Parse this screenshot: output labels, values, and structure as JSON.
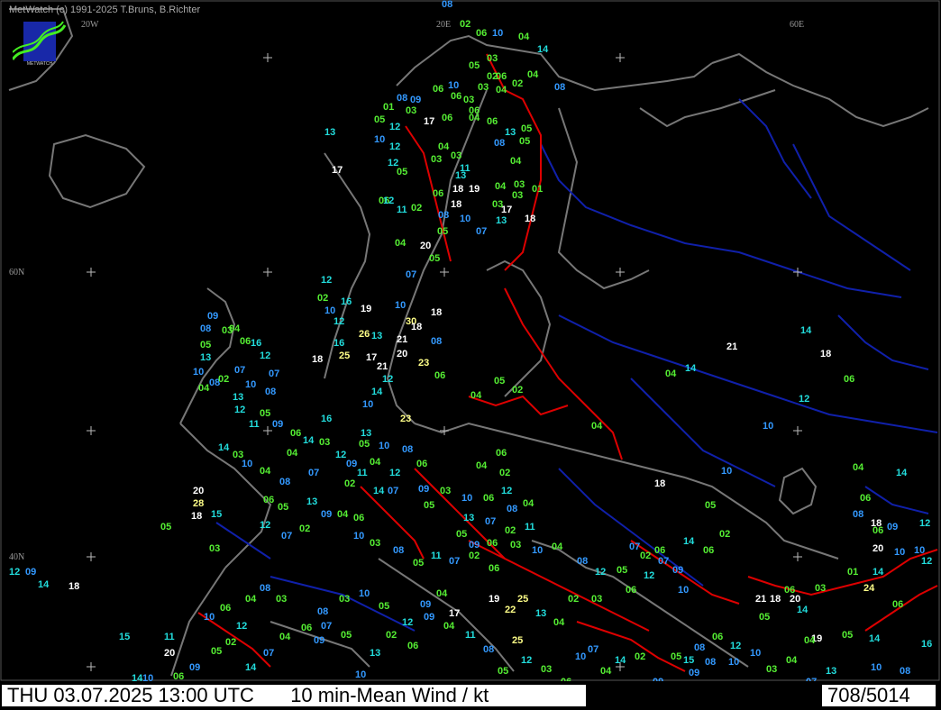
{
  "header": {
    "copyright": "MetWatch  (c) 1991-2025 T.Bruns, B.Richter"
  },
  "logo": {
    "text": "METWATCH",
    "icon": "metwatch-logo-icon"
  },
  "graticule": {
    "lon_labels": [
      "20W",
      "20E",
      "60E"
    ],
    "lat_labels": [
      "60N",
      "40N"
    ]
  },
  "legend": {
    "colors": {
      "calm": "#55ee33",
      "light": "#3399ff",
      "moderate": "#22dddd",
      "strong": "#ffffff",
      "gale": "#ffff88"
    }
  },
  "footer": {
    "datetime": "THU 03.07.2025 13:00 UTC",
    "parameter": "10 min-Mean Wind / kt",
    "count": "708/5014"
  },
  "observations": [
    {
      "v": "08",
      "c": "light"
    },
    {
      "v": "02",
      "c": "calm"
    },
    {
      "v": "06",
      "c": "calm"
    },
    {
      "v": "10",
      "c": "light"
    },
    {
      "v": "04",
      "c": "calm"
    },
    {
      "v": "14",
      "c": "moderate"
    },
    {
      "v": "03",
      "c": "calm"
    },
    {
      "v": "05",
      "c": "calm"
    },
    {
      "v": "06",
      "c": "calm"
    },
    {
      "v": "02",
      "c": "calm"
    },
    {
      "v": "04",
      "c": "calm"
    },
    {
      "v": "04",
      "c": "calm"
    },
    {
      "v": "10",
      "c": "light"
    },
    {
      "v": "06",
      "c": "calm"
    },
    {
      "v": "03",
      "c": "calm"
    },
    {
      "v": "02",
      "c": "calm"
    },
    {
      "v": "03",
      "c": "calm"
    },
    {
      "v": "08",
      "c": "light"
    },
    {
      "v": "08",
      "c": "light"
    },
    {
      "v": "09",
      "c": "light"
    },
    {
      "v": "05",
      "c": "calm"
    },
    {
      "v": "01",
      "c": "calm"
    },
    {
      "v": "03",
      "c": "calm"
    },
    {
      "v": "06",
      "c": "calm"
    },
    {
      "v": "06",
      "c": "calm"
    },
    {
      "v": "04",
      "c": "calm"
    },
    {
      "v": "12",
      "c": "moderate"
    },
    {
      "v": "17",
      "c": "strong"
    },
    {
      "v": "06",
      "c": "calm"
    },
    {
      "v": "06",
      "c": "calm"
    },
    {
      "v": "05",
      "c": "calm"
    },
    {
      "v": "13",
      "c": "moderate"
    },
    {
      "v": "10",
      "c": "light"
    },
    {
      "v": "12",
      "c": "moderate"
    },
    {
      "v": "04",
      "c": "calm"
    },
    {
      "v": "03",
      "c": "calm"
    },
    {
      "v": "08",
      "c": "light"
    },
    {
      "v": "13",
      "c": "moderate"
    },
    {
      "v": "05",
      "c": "calm"
    },
    {
      "v": "04",
      "c": "calm"
    },
    {
      "v": "11",
      "c": "moderate"
    },
    {
      "v": "18",
      "c": "strong"
    },
    {
      "v": "19",
      "c": "strong"
    },
    {
      "v": "04",
      "c": "calm"
    },
    {
      "v": "03",
      "c": "calm"
    },
    {
      "v": "01",
      "c": "calm"
    },
    {
      "v": "17",
      "c": "strong"
    },
    {
      "v": "12",
      "c": "moderate"
    },
    {
      "v": "03",
      "c": "calm"
    },
    {
      "v": "05",
      "c": "calm"
    },
    {
      "v": "13",
      "c": "moderate"
    },
    {
      "v": "06",
      "c": "calm"
    },
    {
      "v": "11",
      "c": "moderate"
    },
    {
      "v": "12",
      "c": "moderate"
    },
    {
      "v": "18",
      "c": "strong"
    },
    {
      "v": "03",
      "c": "calm"
    },
    {
      "v": "03",
      "c": "calm"
    },
    {
      "v": "17",
      "c": "strong"
    },
    {
      "v": "10",
      "c": "light"
    },
    {
      "v": "08",
      "c": "light"
    },
    {
      "v": "02",
      "c": "calm"
    },
    {
      "v": "06",
      "c": "calm"
    },
    {
      "v": "05",
      "c": "calm"
    },
    {
      "v": "13",
      "c": "moderate"
    },
    {
      "v": "07",
      "c": "light"
    },
    {
      "v": "18",
      "c": "strong"
    },
    {
      "v": "20",
      "c": "strong"
    },
    {
      "v": "04",
      "c": "calm"
    },
    {
      "v": "05",
      "c": "calm"
    },
    {
      "v": "07",
      "c": "light"
    },
    {
      "v": "12",
      "c": "moderate"
    },
    {
      "v": "02",
      "c": "calm"
    },
    {
      "v": "16",
      "c": "moderate"
    },
    {
      "v": "19",
      "c": "strong"
    },
    {
      "v": "10",
      "c": "light"
    },
    {
      "v": "12",
      "c": "moderate"
    },
    {
      "v": "26",
      "c": "gale"
    },
    {
      "v": "13",
      "c": "moderate"
    },
    {
      "v": "21",
      "c": "strong"
    },
    {
      "v": "18",
      "c": "strong"
    },
    {
      "v": "30",
      "c": "gale"
    },
    {
      "v": "10",
      "c": "light"
    },
    {
      "v": "18",
      "c": "strong"
    },
    {
      "v": "16",
      "c": "moderate"
    },
    {
      "v": "25",
      "c": "gale"
    },
    {
      "v": "17",
      "c": "strong"
    },
    {
      "v": "20",
      "c": "strong"
    },
    {
      "v": "21",
      "c": "strong"
    },
    {
      "v": "18",
      "c": "strong"
    },
    {
      "v": "23",
      "c": "gale"
    },
    {
      "v": "12",
      "c": "moderate"
    },
    {
      "v": "14",
      "c": "moderate"
    },
    {
      "v": "10",
      "c": "light"
    },
    {
      "v": "23",
      "c": "gale"
    },
    {
      "v": "08",
      "c": "light"
    },
    {
      "v": "06",
      "c": "calm"
    },
    {
      "v": "04",
      "c": "calm"
    },
    {
      "v": "05",
      "c": "calm"
    },
    {
      "v": "02",
      "c": "calm"
    },
    {
      "v": "06",
      "c": "calm"
    },
    {
      "v": "04",
      "c": "calm"
    },
    {
      "v": "02",
      "c": "calm"
    },
    {
      "v": "20",
      "c": "strong"
    },
    {
      "v": "28",
      "c": "gale"
    },
    {
      "v": "18",
      "c": "strong"
    },
    {
      "v": "15",
      "c": "moderate"
    },
    {
      "v": "05",
      "c": "calm"
    },
    {
      "v": "03",
      "c": "calm"
    },
    {
      "v": "12",
      "c": "moderate"
    },
    {
      "v": "09",
      "c": "light"
    },
    {
      "v": "14",
      "c": "moderate"
    },
    {
      "v": "18",
      "c": "strong"
    },
    {
      "v": "25",
      "c": "gale"
    },
    {
      "v": "11",
      "c": "moderate"
    },
    {
      "v": "15",
      "c": "moderate"
    },
    {
      "v": "20",
      "c": "strong"
    },
    {
      "v": "14",
      "c": "moderate"
    },
    {
      "v": "10",
      "c": "light"
    },
    {
      "v": "06",
      "c": "calm"
    },
    {
      "v": "09",
      "c": "light"
    },
    {
      "v": "17",
      "c": "strong"
    },
    {
      "v": "19",
      "c": "strong"
    },
    {
      "v": "22",
      "c": "gale"
    },
    {
      "v": "25",
      "c": "gale"
    },
    {
      "v": "13",
      "c": "moderate"
    },
    {
      "v": "04",
      "c": "calm"
    },
    {
      "v": "02",
      "c": "calm"
    },
    {
      "v": "03",
      "c": "calm"
    },
    {
      "v": "06",
      "c": "calm"
    },
    {
      "v": "12",
      "c": "moderate"
    },
    {
      "v": "07",
      "c": "light"
    },
    {
      "v": "10",
      "c": "light"
    },
    {
      "v": "14",
      "c": "moderate"
    },
    {
      "v": "06",
      "c": "calm"
    },
    {
      "v": "15",
      "c": "moderate"
    },
    {
      "v": "08",
      "c": "light"
    },
    {
      "v": "09",
      "c": "light"
    },
    {
      "v": "10",
      "c": "light"
    },
    {
      "v": "21",
      "c": "strong"
    },
    {
      "v": "20",
      "c": "strong"
    },
    {
      "v": "18",
      "c": "strong"
    },
    {
      "v": "24",
      "c": "gale"
    },
    {
      "v": "20",
      "c": "strong"
    },
    {
      "v": "14",
      "c": "moderate"
    },
    {
      "v": "08",
      "c": "light"
    },
    {
      "v": "06",
      "c": "calm"
    },
    {
      "v": "10",
      "c": "light"
    },
    {
      "v": "19",
      "c": "strong"
    },
    {
      "v": "16",
      "c": "moderate"
    },
    {
      "v": "02",
      "c": "calm"
    },
    {
      "v": "04",
      "c": "calm"
    },
    {
      "v": "14",
      "c": "moderate"
    },
    {
      "v": "10",
      "c": "light"
    },
    {
      "v": "05",
      "c": "calm"
    },
    {
      "v": "04",
      "c": "calm"
    },
    {
      "v": "18",
      "c": "strong"
    },
    {
      "v": "21",
      "c": "strong"
    },
    {
      "v": "18",
      "c": "strong"
    },
    {
      "v": "14",
      "c": "moderate"
    },
    {
      "v": "12",
      "c": "moderate"
    },
    {
      "v": "10",
      "c": "light"
    },
    {
      "v": "06",
      "c": "calm"
    },
    {
      "v": "04",
      "c": "calm"
    },
    {
      "v": "18",
      "c": "strong"
    },
    {
      "v": "10",
      "c": "light"
    },
    {
      "v": "06",
      "c": "calm"
    },
    {
      "v": "04",
      "c": "calm"
    },
    {
      "v": "14",
      "c": "moderate"
    },
    {
      "v": "08",
      "c": "light"
    },
    {
      "v": "10",
      "c": "light"
    },
    {
      "v": "06",
      "c": "calm"
    },
    {
      "v": "12",
      "c": "moderate"
    },
    {
      "v": "09",
      "c": "light"
    },
    {
      "v": "05",
      "c": "calm"
    },
    {
      "v": "03",
      "c": "calm"
    },
    {
      "v": "01",
      "c": "calm"
    },
    {
      "v": "14",
      "c": "moderate"
    },
    {
      "v": "12",
      "c": "moderate"
    },
    {
      "v": "14",
      "c": "moderate"
    },
    {
      "v": "06",
      "c": "calm"
    },
    {
      "v": "10",
      "c": "light"
    },
    {
      "v": "08",
      "c": "light"
    },
    {
      "v": "04",
      "c": "calm"
    },
    {
      "v": "02",
      "c": "calm"
    },
    {
      "v": "07",
      "c": "light"
    },
    {
      "v": "13",
      "c": "moderate"
    },
    {
      "v": "08",
      "c": "light"
    },
    {
      "v": "03",
      "c": "calm"
    },
    {
      "v": "05",
      "c": "calm"
    },
    {
      "v": "06",
      "c": "calm"
    },
    {
      "v": "09",
      "c": "light"
    },
    {
      "v": "04",
      "c": "calm"
    },
    {
      "v": "16",
      "c": "moderate"
    },
    {
      "v": "12",
      "c": "moderate"
    },
    {
      "v": "10",
      "c": "light"
    },
    {
      "v": "07",
      "c": "light"
    },
    {
      "v": "13",
      "c": "moderate"
    },
    {
      "v": "11",
      "c": "moderate"
    },
    {
      "v": "12",
      "c": "moderate"
    },
    {
      "v": "08",
      "c": "light"
    },
    {
      "v": "05",
      "c": "calm"
    },
    {
      "v": "09",
      "c": "light"
    },
    {
      "v": "04",
      "c": "calm"
    },
    {
      "v": "14",
      "c": "moderate"
    },
    {
      "v": "06",
      "c": "calm"
    },
    {
      "v": "16",
      "c": "moderate"
    },
    {
      "v": "03",
      "c": "calm"
    },
    {
      "v": "12",
      "c": "moderate"
    },
    {
      "v": "07",
      "c": "light"
    },
    {
      "v": "09",
      "c": "light"
    },
    {
      "v": "13",
      "c": "moderate"
    },
    {
      "v": "05",
      "c": "calm"
    },
    {
      "v": "10",
      "c": "light"
    },
    {
      "v": "08",
      "c": "light"
    },
    {
      "v": "04",
      "c": "calm"
    },
    {
      "v": "12",
      "c": "moderate"
    },
    {
      "v": "06",
      "c": "calm"
    },
    {
      "v": "11",
      "c": "moderate"
    },
    {
      "v": "02",
      "c": "calm"
    },
    {
      "v": "14",
      "c": "moderate"
    },
    {
      "v": "07",
      "c": "light"
    },
    {
      "v": "09",
      "c": "light"
    },
    {
      "v": "05",
      "c": "calm"
    },
    {
      "v": "03",
      "c": "calm"
    },
    {
      "v": "10",
      "c": "light"
    },
    {
      "v": "06",
      "c": "calm"
    },
    {
      "v": "12",
      "c": "moderate"
    },
    {
      "v": "08",
      "c": "light"
    },
    {
      "v": "04",
      "c": "calm"
    },
    {
      "v": "13",
      "c": "moderate"
    },
    {
      "v": "07",
      "c": "light"
    },
    {
      "v": "02",
      "c": "calm"
    },
    {
      "v": "11",
      "c": "moderate"
    },
    {
      "v": "05",
      "c": "calm"
    },
    {
      "v": "09",
      "c": "light"
    },
    {
      "v": "06",
      "c": "calm"
    },
    {
      "v": "03",
      "c": "calm"
    },
    {
      "v": "10",
      "c": "light"
    },
    {
      "v": "04",
      "c": "calm"
    },
    {
      "v": "08",
      "c": "light"
    },
    {
      "v": "12",
      "c": "moderate"
    },
    {
      "v": "05",
      "c": "calm"
    },
    {
      "v": "07",
      "c": "light"
    },
    {
      "v": "02",
      "c": "calm"
    },
    {
      "v": "06",
      "c": "calm"
    },
    {
      "v": "09",
      "c": "light"
    },
    {
      "v": "14",
      "c": "moderate"
    },
    {
      "v": "03",
      "c": "calm"
    },
    {
      "v": "10",
      "c": "light"
    },
    {
      "v": "04",
      "c": "calm"
    },
    {
      "v": "08",
      "c": "light"
    },
    {
      "v": "06",
      "c": "calm"
    },
    {
      "v": "05",
      "c": "calm"
    },
    {
      "v": "12",
      "c": "moderate"
    },
    {
      "v": "07",
      "c": "light"
    },
    {
      "v": "02",
      "c": "calm"
    },
    {
      "v": "13",
      "c": "moderate"
    },
    {
      "v": "09",
      "c": "light"
    },
    {
      "v": "04",
      "c": "calm"
    },
    {
      "v": "06",
      "c": "calm"
    },
    {
      "v": "10",
      "c": "light"
    },
    {
      "v": "03",
      "c": "calm"
    },
    {
      "v": "08",
      "c": "light"
    },
    {
      "v": "05",
      "c": "calm"
    },
    {
      "v": "11",
      "c": "moderate"
    },
    {
      "v": "07",
      "c": "light"
    },
    {
      "v": "02",
      "c": "calm"
    },
    {
      "v": "06",
      "c": "calm"
    },
    {
      "v": "04",
      "c": "calm"
    },
    {
      "v": "09",
      "c": "light"
    },
    {
      "v": "12",
      "c": "moderate"
    },
    {
      "v": "05",
      "c": "calm"
    },
    {
      "v": "10",
      "c": "light"
    },
    {
      "v": "03",
      "c": "calm"
    },
    {
      "v": "08",
      "c": "light"
    },
    {
      "v": "06",
      "c": "calm"
    },
    {
      "v": "04",
      "c": "calm"
    },
    {
      "v": "07",
      "c": "light"
    },
    {
      "v": "14",
      "c": "moderate"
    },
    {
      "v": "02",
      "c": "calm"
    },
    {
      "v": "05",
      "c": "calm"
    },
    {
      "v": "09",
      "c": "light"
    },
    {
      "v": "10",
      "c": "light"
    },
    {
      "v": "06",
      "c": "calm"
    },
    {
      "v": "12",
      "c": "moderate"
    },
    {
      "v": "04",
      "c": "calm"
    },
    {
      "v": "08",
      "c": "light"
    },
    {
      "v": "03",
      "c": "calm"
    },
    {
      "v": "13",
      "c": "moderate"
    },
    {
      "v": "05",
      "c": "calm"
    },
    {
      "v": "07",
      "c": "light"
    },
    {
      "v": "10",
      "c": "light"
    },
    {
      "v": "02",
      "c": "calm"
    },
    {
      "v": "06",
      "c": "calm"
    },
    {
      "v": "09",
      "c": "light"
    },
    {
      "v": "04",
      "c": "calm"
    },
    {
      "v": "11",
      "c": "moderate"
    },
    {
      "v": "08",
      "c": "light"
    },
    {
      "v": "05",
      "c": "calm"
    },
    {
      "v": "12",
      "c": "moderate"
    },
    {
      "v": "03",
      "c": "calm"
    },
    {
      "v": "06",
      "c": "calm"
    },
    {
      "v": "10",
      "c": "light"
    },
    {
      "v": "07",
      "c": "light"
    },
    {
      "v": "04",
      "c": "calm"
    },
    {
      "v": "14",
      "c": "moderate"
    },
    {
      "v": "02",
      "c": "calm"
    },
    {
      "v": "09",
      "c": "light"
    },
    {
      "v": "05",
      "c": "calm"
    },
    {
      "v": "08",
      "c": "light"
    },
    {
      "v": "06",
      "c": "calm"
    },
    {
      "v": "12",
      "c": "moderate"
    },
    {
      "v": "10",
      "c": "light"
    },
    {
      "v": "03",
      "c": "calm"
    },
    {
      "v": "04",
      "c": "calm"
    },
    {
      "v": "07",
      "c": "light"
    },
    {
      "v": "13",
      "c": "moderate"
    },
    {
      "v": "05",
      "c": "calm"
    }
  ]
}
